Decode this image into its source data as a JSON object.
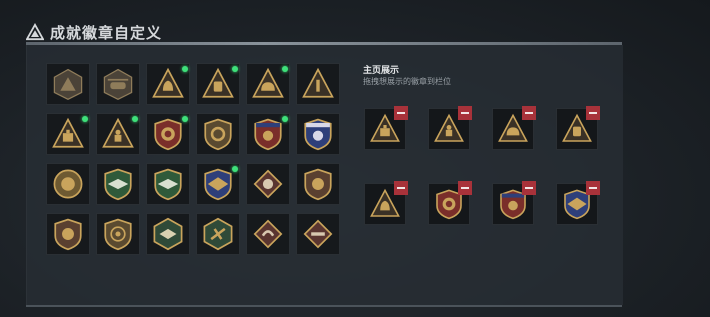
{
  "header": {
    "title": "成就徽章自定义"
  },
  "showcase": {
    "title": "主页展示",
    "subtitle": "拖拽想展示的徽章到栏位"
  },
  "colors": {
    "accent_new": "#3ee07a",
    "remove": "#a8323a",
    "gold": "#c9a45c"
  },
  "badges": [
    {
      "icon": "mountain-triangle-badge-icon",
      "new": false
    },
    {
      "icon": "helicopter-badge-icon",
      "new": false
    },
    {
      "icon": "bell-triangle-badge-icon",
      "new": true
    },
    {
      "icon": "backpack-triangle-badge-icon",
      "new": true
    },
    {
      "icon": "helmet-triangle-badge-icon",
      "new": true
    },
    {
      "icon": "number-one-triangle-badge-icon",
      "new": false
    },
    {
      "icon": "weight-triangle-badge-icon",
      "new": true
    },
    {
      "icon": "soldier-triangle-badge-icon",
      "new": true
    },
    {
      "icon": "sunburst-shield-badge-icon",
      "new": true
    },
    {
      "icon": "shield-gear-badge-icon",
      "new": false
    },
    {
      "icon": "star-crest-badge-icon",
      "new": true
    },
    {
      "icon": "blue-star-crest-badge-icon",
      "new": false
    },
    {
      "icon": "lion-round-badge-icon",
      "new": false
    },
    {
      "icon": "green-wings-shield-badge-icon",
      "new": false
    },
    {
      "icon": "green-wings-shield-badge-icon",
      "new": false
    },
    {
      "icon": "blue-eagle-shield-badge-icon",
      "new": true
    },
    {
      "icon": "tiger-diamond-badge-icon",
      "new": false
    },
    {
      "icon": "lion-shield-badge-icon",
      "new": false
    },
    {
      "icon": "lion-shield-badge-icon",
      "new": false
    },
    {
      "icon": "target-shield-badge-icon",
      "new": false
    },
    {
      "icon": "eagle-hexagon-badge-icon",
      "new": false
    },
    {
      "icon": "plane-hexagon-badge-icon",
      "new": false
    },
    {
      "icon": "dragon-diamond-badge-icon",
      "new": false
    },
    {
      "icon": "gun-diamond-badge-icon",
      "new": false
    }
  ],
  "slots": [
    {
      "icon": "weight-triangle-badge-icon"
    },
    {
      "icon": "soldier-triangle-badge-icon"
    },
    {
      "icon": "helmet-triangle-badge-icon"
    },
    {
      "icon": "backpack-triangle-badge-icon"
    },
    {
      "icon": "bell-triangle-badge-icon"
    },
    {
      "icon": "sunburst-shield-badge-icon"
    },
    {
      "icon": "star-crest-badge-icon"
    },
    {
      "icon": "blue-eagle-shield-badge-icon"
    }
  ]
}
